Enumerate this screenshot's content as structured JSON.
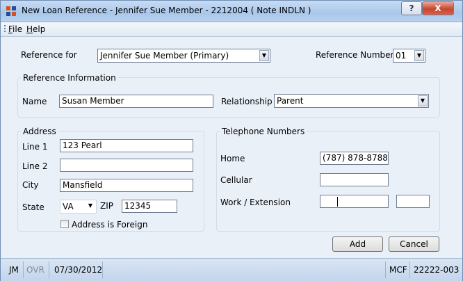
{
  "window": {
    "title": "New Loan Reference - Jennifer Sue Member - 2212004 ( Note  INDLN )",
    "help_label": "?",
    "close_label": "X"
  },
  "menu": {
    "file": {
      "accel": "F",
      "rest": "ile"
    },
    "help": {
      "accel": "H",
      "rest": "elp"
    }
  },
  "form": {
    "reference_for_label": "Reference for",
    "reference_for_value": "Jennifer Sue Member (Primary)",
    "reference_number_label": "Reference Number",
    "reference_number_value": "01",
    "reference_info": {
      "title": "Reference Information",
      "name_label": "Name",
      "name_value": "Susan Member",
      "relationship_label": "Relationship",
      "relationship_value": "Parent"
    },
    "address": {
      "title": "Address",
      "line1_label": "Line 1",
      "line1_value": "123 Pearl",
      "line2_label": "Line 2",
      "line2_value": "",
      "city_label": "City",
      "city_value": "Mansfield",
      "state_label": "State",
      "state_value": "VA",
      "zip_label": "ZIP",
      "zip_value": "12345",
      "foreign_label": "Address is Foreign"
    },
    "telephone": {
      "title": "Telephone Numbers",
      "home_label": "Home",
      "home_value": "(787) 878-8788",
      "cellular_label": "Cellular",
      "cellular_value": "",
      "work_label": "Work / Extension",
      "work_value": "",
      "extension_value": ""
    },
    "buttons": {
      "add": "Add",
      "cancel": "Cancel"
    }
  },
  "status": {
    "user": "JM",
    "ovr": "OVR",
    "date": "07/30/2012",
    "mode": "MCF",
    "code": "22222-003"
  }
}
